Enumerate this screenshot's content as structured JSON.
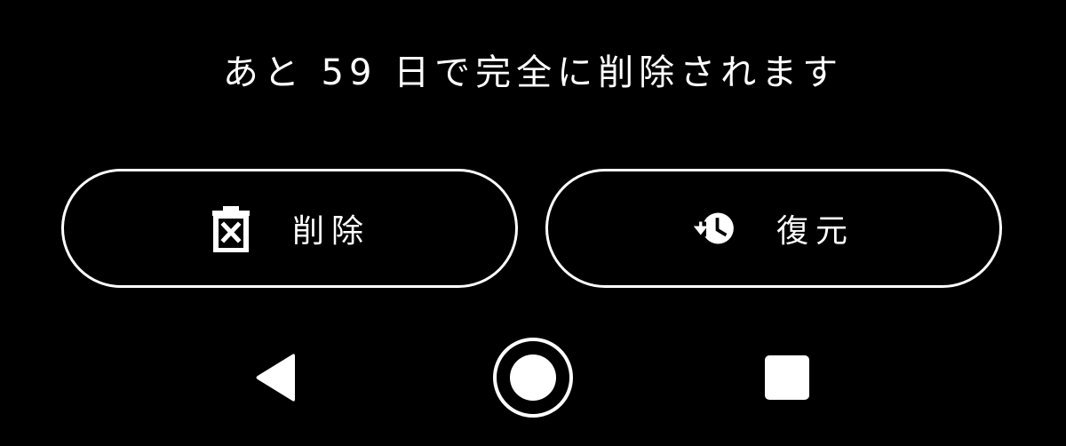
{
  "notice": {
    "text": "あと 59 日で完全に削除されます"
  },
  "actions": {
    "delete": {
      "label": "削除",
      "icon": "trash-icon"
    },
    "restore": {
      "label": "復元",
      "icon": "history-icon"
    }
  },
  "navigation": {
    "back_icon": "back-icon",
    "home_icon": "home-icon",
    "recents_icon": "recents-icon"
  },
  "colors": {
    "background": "#000000",
    "foreground": "#ffffff"
  }
}
